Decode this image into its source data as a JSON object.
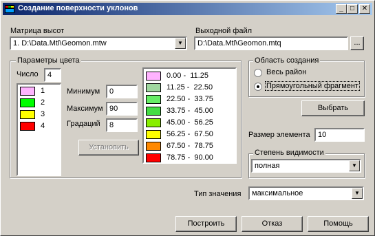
{
  "window": {
    "title": "Создание поверхности уклонов"
  },
  "matrix": {
    "label": "Матрица высот",
    "value": "1. D:\\Data.Mtl\\Geomon.mtw"
  },
  "output": {
    "label": "Выходной файл",
    "value": "D:\\Data.Mtl\\Geomon.mtq",
    "browse_label": "..."
  },
  "color_params": {
    "group_label": "Параметры цвета",
    "count_label": "Число",
    "count_value": "4",
    "colors": [
      {
        "num": "1",
        "color": "#ffb3ff"
      },
      {
        "num": "2",
        "color": "#00ff00"
      },
      {
        "num": "3",
        "color": "#ffff00"
      },
      {
        "num": "4",
        "color": "#ff0000"
      }
    ],
    "min_label": "Минимум",
    "min_value": "0",
    "max_label": "Максимум",
    "max_value": "90",
    "grad_label": "Градаций",
    "grad_value": "8",
    "set_button": "Установить"
  },
  "legend": [
    {
      "range": "0.00 -  11.25",
      "color": "#ffb3ff"
    },
    {
      "range": "11.25 -  22.50",
      "color": "#a0d8a0"
    },
    {
      "range": "22.50 -  33.75",
      "color": "#66ee66"
    },
    {
      "range": "33.75 -  45.00",
      "color": "#44dd44"
    },
    {
      "range": "45.00 -  56.25",
      "color": "#88ee00"
    },
    {
      "range": "56.25 -  67.50",
      "color": "#ffff00"
    },
    {
      "range": "67.50 -  78.75",
      "color": "#ff8800"
    },
    {
      "range": "78.75 -  90.00",
      "color": "#ff0000"
    }
  ],
  "area": {
    "group_label": "Область создания",
    "option_all": "Весь район",
    "option_rect": "Прямоугольный фрагмент",
    "selected": "rect"
  },
  "select_button": "Выбрать",
  "element_size": {
    "label": "Размер элемента",
    "value": "10"
  },
  "visibility": {
    "group_label": "Степень видимости",
    "value": "полная"
  },
  "value_type": {
    "label": "Тип значения",
    "value": "максимальное"
  },
  "buttons": {
    "build": "Построить",
    "cancel": "Отказ",
    "help": "Помощь"
  }
}
